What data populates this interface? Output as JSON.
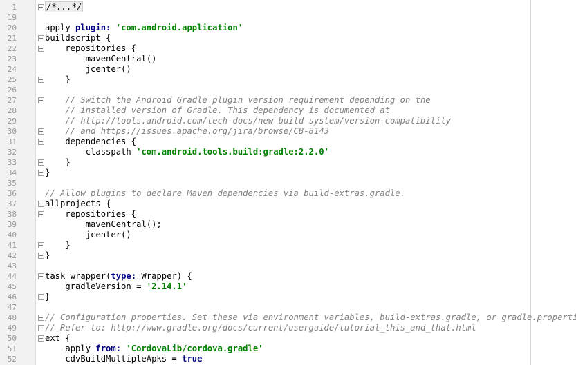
{
  "editor": {
    "lines": [
      {
        "n": "1",
        "fold": "plus",
        "tokens": [
          {
            "t": "/*...*/",
            "c": "collapsed"
          }
        ]
      },
      {
        "n": "19",
        "fold": "",
        "tokens": []
      },
      {
        "n": "20",
        "fold": "",
        "tokens": [
          {
            "t": "apply ",
            "c": "p"
          },
          {
            "t": "plugin: ",
            "c": "k"
          },
          {
            "t": "'com.android.application'",
            "c": "s"
          }
        ]
      },
      {
        "n": "21",
        "fold": "minus",
        "tokens": [
          {
            "t": "buildscript {",
            "c": "p"
          }
        ]
      },
      {
        "n": "22",
        "fold": "minus",
        "tokens": [
          {
            "t": "    repositories {",
            "c": "p"
          }
        ]
      },
      {
        "n": "23",
        "fold": "",
        "tokens": [
          {
            "t": "        mavenCentral()",
            "c": "p"
          }
        ]
      },
      {
        "n": "24",
        "fold": "",
        "tokens": [
          {
            "t": "        jcenter()",
            "c": "p"
          }
        ]
      },
      {
        "n": "25",
        "fold": "minus",
        "tokens": [
          {
            "t": "    }",
            "c": "p"
          }
        ]
      },
      {
        "n": "26",
        "fold": "",
        "tokens": []
      },
      {
        "n": "27",
        "fold": "minus",
        "tokens": [
          {
            "t": "    // Switch the Android Gradle plugin version requirement depending on the",
            "c": "c"
          }
        ]
      },
      {
        "n": "28",
        "fold": "",
        "tokens": [
          {
            "t": "    // installed version of Gradle. This dependency is documented at",
            "c": "c"
          }
        ]
      },
      {
        "n": "29",
        "fold": "",
        "tokens": [
          {
            "t": "    // http://tools.android.com/tech-docs/new-build-system/version-compatibility",
            "c": "c"
          }
        ]
      },
      {
        "n": "30",
        "fold": "minus",
        "tokens": [
          {
            "t": "    // and https://issues.apache.org/jira/browse/CB-8143",
            "c": "c"
          }
        ]
      },
      {
        "n": "31",
        "fold": "minus",
        "tokens": [
          {
            "t": "    dependencies {",
            "c": "p"
          }
        ]
      },
      {
        "n": "32",
        "fold": "",
        "tokens": [
          {
            "t": "        classpath ",
            "c": "p"
          },
          {
            "t": "'com.android.tools.build:gradle:2.2.0'",
            "c": "s"
          }
        ]
      },
      {
        "n": "33",
        "fold": "minus",
        "tokens": [
          {
            "t": "    }",
            "c": "p"
          }
        ]
      },
      {
        "n": "34",
        "fold": "minus",
        "tokens": [
          {
            "t": "}",
            "c": "p"
          }
        ]
      },
      {
        "n": "35",
        "fold": "",
        "tokens": []
      },
      {
        "n": "36",
        "fold": "",
        "tokens": [
          {
            "t": "// Allow plugins to declare Maven dependencies via build-extras.gradle.",
            "c": "c"
          }
        ]
      },
      {
        "n": "37",
        "fold": "minus",
        "tokens": [
          {
            "t": "allprojects {",
            "c": "p"
          }
        ]
      },
      {
        "n": "38",
        "fold": "minus",
        "tokens": [
          {
            "t": "    repositories {",
            "c": "p"
          }
        ]
      },
      {
        "n": "39",
        "fold": "",
        "tokens": [
          {
            "t": "        mavenCentral();",
            "c": "p"
          }
        ]
      },
      {
        "n": "40",
        "fold": "",
        "tokens": [
          {
            "t": "        jcenter()",
            "c": "p"
          }
        ]
      },
      {
        "n": "41",
        "fold": "minus",
        "tokens": [
          {
            "t": "    }",
            "c": "p"
          }
        ]
      },
      {
        "n": "42",
        "fold": "minus",
        "tokens": [
          {
            "t": "}",
            "c": "p"
          }
        ]
      },
      {
        "n": "43",
        "fold": "",
        "tokens": []
      },
      {
        "n": "44",
        "fold": "minus",
        "tokens": [
          {
            "t": "task wrapper(",
            "c": "p"
          },
          {
            "t": "type: ",
            "c": "k"
          },
          {
            "t": "Wrapper) {",
            "c": "p"
          }
        ]
      },
      {
        "n": "45",
        "fold": "",
        "tokens": [
          {
            "t": "    gradleVersion = ",
            "c": "p"
          },
          {
            "t": "'2.14.1'",
            "c": "s"
          }
        ]
      },
      {
        "n": "46",
        "fold": "minus",
        "tokens": [
          {
            "t": "}",
            "c": "p"
          }
        ]
      },
      {
        "n": "47",
        "fold": "",
        "tokens": []
      },
      {
        "n": "48",
        "fold": "minus",
        "tokens": [
          {
            "t": "// Configuration properties. Set these via environment variables, build-extras.gradle, or gradle.properties.",
            "c": "c"
          }
        ]
      },
      {
        "n": "49",
        "fold": "minus",
        "tokens": [
          {
            "t": "// Refer to: http://www.gradle.org/docs/current/userguide/tutorial_this_and_that.html",
            "c": "c"
          }
        ]
      },
      {
        "n": "50",
        "fold": "minus",
        "tokens": [
          {
            "t": "ext {",
            "c": "p"
          }
        ]
      },
      {
        "n": "51",
        "fold": "",
        "tokens": [
          {
            "t": "    apply ",
            "c": "p"
          },
          {
            "t": "from: ",
            "c": "k"
          },
          {
            "t": "'CordovaLib/cordova.gradle'",
            "c": "s"
          }
        ]
      },
      {
        "n": "52",
        "fold": "",
        "tokens": [
          {
            "t": "    cdvBuildMultipleApks = ",
            "c": "p"
          },
          {
            "t": "true",
            "c": "k"
          }
        ]
      }
    ]
  },
  "colors": {
    "keyword": "#000080",
    "string": "#008000",
    "comment": "#808080",
    "line_number": "#999999",
    "gutter_bg": "#f2f2f2"
  }
}
